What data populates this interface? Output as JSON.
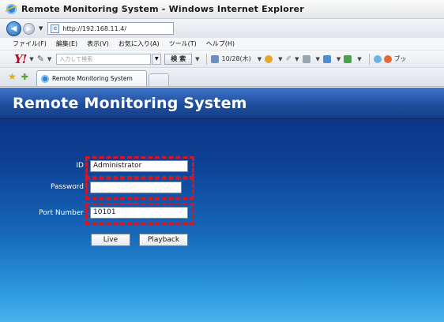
{
  "window": {
    "title": "Remote Monitoring System - Windows Internet Explorer"
  },
  "address": {
    "url": "http://192.168.11.4/"
  },
  "menu": {
    "items": [
      "ファイル(F)",
      "編集(E)",
      "表示(V)",
      "お気に入り(A)",
      "ツール(T)",
      "ヘルプ(H)"
    ]
  },
  "yahoo_toolbar": {
    "logo": "Y!",
    "search_placeholder": "入力して検索",
    "search_button": "検 索",
    "date_text": "10/28(木)",
    "trailing_text": "ブッ"
  },
  "tabs": {
    "active_label": "Remote Monitoring System"
  },
  "page": {
    "title": "Remote Monitoring System",
    "form": {
      "id_label": "ID",
      "id_value": "Administrator",
      "password_label": "Password",
      "password_value": "",
      "port_label": "Port Number",
      "port_value": "10101"
    },
    "buttons": {
      "live": "Live",
      "playback": "Playback"
    }
  },
  "colors": {
    "highlight": "#d1182b",
    "page_top": "#0a2f7c",
    "page_bottom": "#46b2ec"
  }
}
